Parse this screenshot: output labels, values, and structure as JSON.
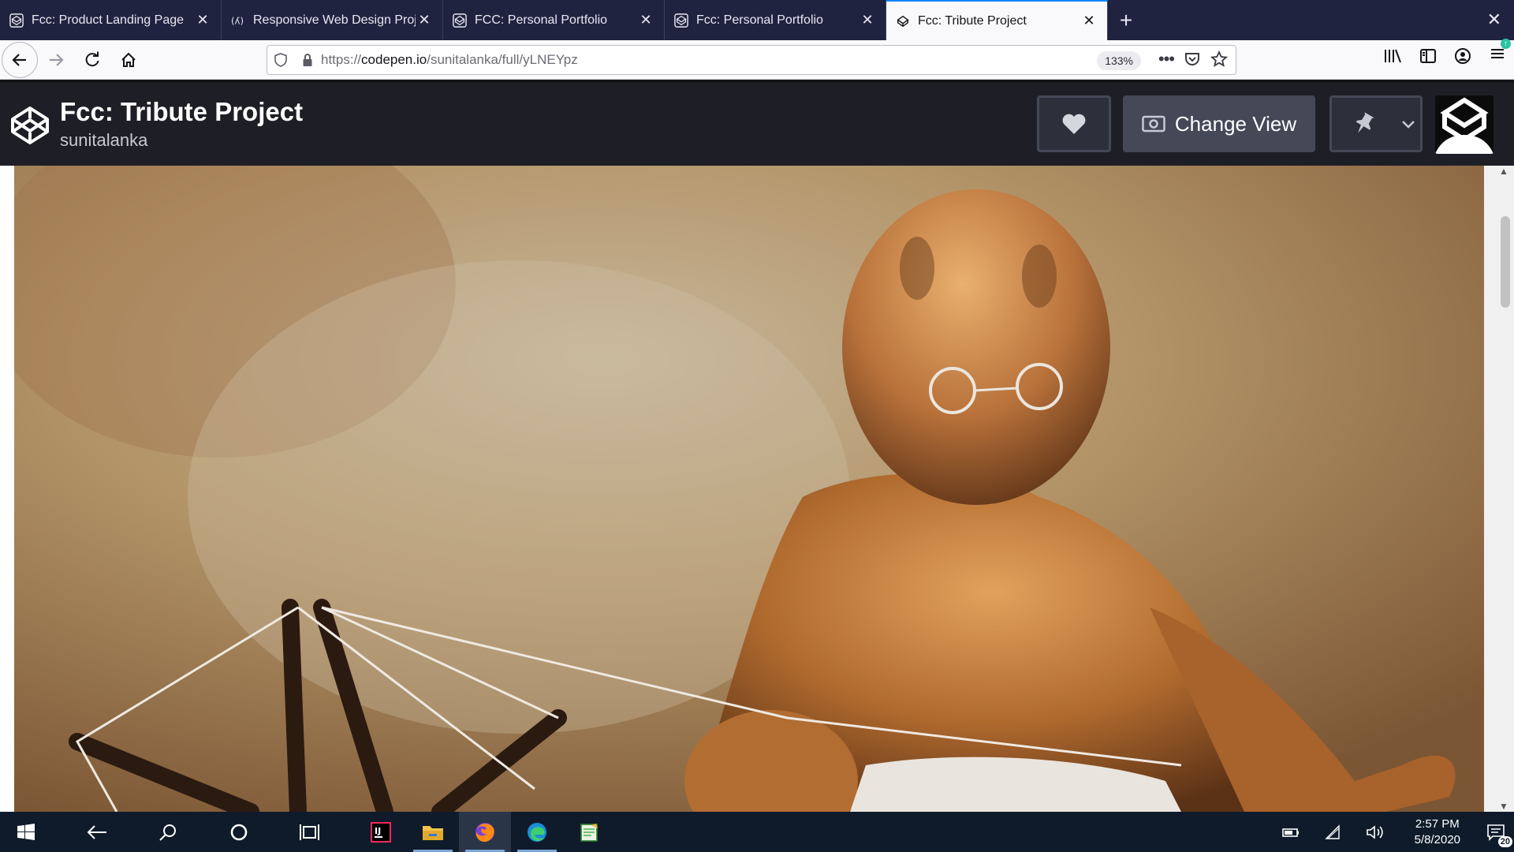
{
  "browser": {
    "tabs": [
      {
        "label": "Fcc: Product Landing Page",
        "icon": "codepen-icon"
      },
      {
        "label": "Responsive Web Design Proje",
        "icon": "freecodecamp-icon"
      },
      {
        "label": "FCC: Personal Portfolio",
        "icon": "codepen-icon"
      },
      {
        "label": "Fcc: Personal Portfolio",
        "icon": "codepen-icon"
      },
      {
        "label": "Fcc: Tribute Project",
        "icon": "codepen-icon",
        "active": true
      }
    ],
    "url": {
      "scheme": "https://",
      "host": "codepen.io",
      "path": "/sunitalanka/full/yLNEYpz"
    },
    "zoom": "133%"
  },
  "codepen": {
    "title": "Fcc: Tribute Project",
    "owner": "sunitalanka",
    "change_view": "Change View"
  },
  "page": {
    "image_subject": "painting of Gandhi seated at a spinning wheel (charkha)"
  },
  "taskbar": {
    "time": "2:57 PM",
    "date": "5/8/2020",
    "notifications": "20"
  },
  "colors": {
    "tabbar": "#202340",
    "codepen_header": "#1e1f26",
    "accent": "#0a84ff",
    "taskbar": "#0f1b2b"
  }
}
